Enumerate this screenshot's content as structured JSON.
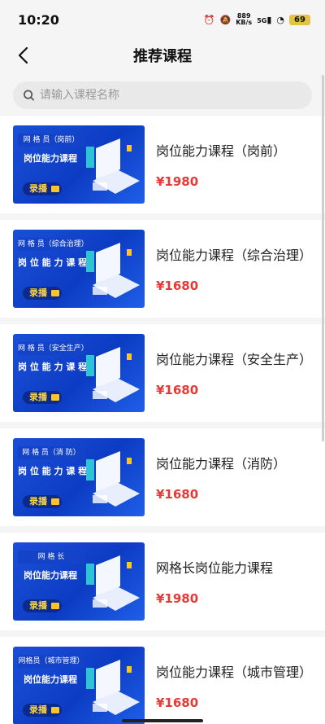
{
  "status": {
    "time": "10:20",
    "net_speed": "889",
    "net_unit": "KB/s",
    "signal": "5G",
    "battery": "69"
  },
  "nav": {
    "title": "推荐课程"
  },
  "search": {
    "placeholder": "请输入课程名称"
  },
  "courses": [
    {
      "title": "岗位能力课程（岗前）",
      "price": "¥1980",
      "thumb_sub": "网 格 员（岗前）",
      "thumb_main": "岗位能力课程",
      "thumb_tag": "录播"
    },
    {
      "title": "岗位能力课程（综合治理）",
      "price": "¥1680",
      "thumb_sub": "网 格 员（综合治理）",
      "thumb_main": "岗 位 能 力 课 程",
      "thumb_tag": "录播"
    },
    {
      "title": "岗位能力课程（安全生产）",
      "price": "¥1680",
      "thumb_sub": "网 格 员（安全生产）",
      "thumb_main": "岗 位 能 力 课 程",
      "thumb_tag": "录播"
    },
    {
      "title": "岗位能力课程（消防）",
      "price": "¥1680",
      "thumb_sub": "网 格 员（消 防）",
      "thumb_main": "岗 位 能 力 课 程",
      "thumb_tag": "录播"
    },
    {
      "title": "网格长岗位能力课程",
      "price": "¥1980",
      "thumb_sub": "网 格 长",
      "thumb_main": "岗位能力课程",
      "thumb_tag": "录播"
    },
    {
      "title": "岗位能力课程（城市管理）",
      "price": "¥1680",
      "thumb_sub": "网格员（城市管理）",
      "thumb_main": "岗位能力课程",
      "thumb_tag": "录播"
    }
  ]
}
